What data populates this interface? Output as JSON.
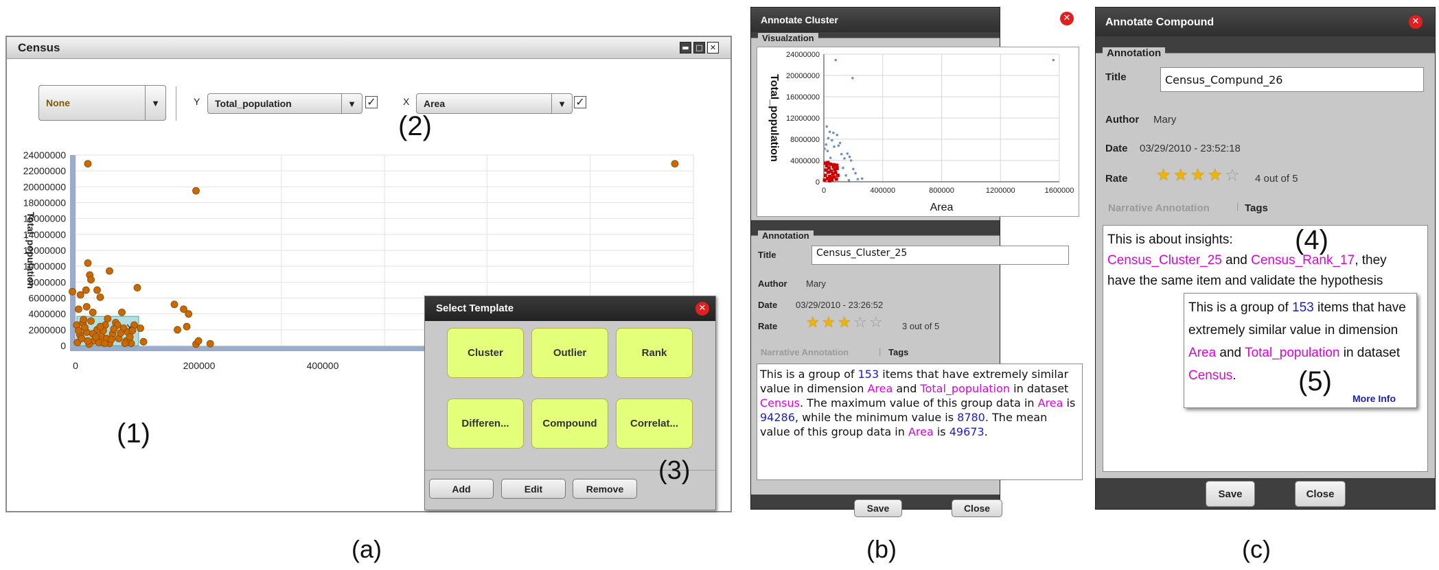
{
  "panel_a": {
    "window_title": "Census",
    "color_by": "None",
    "y_axis_letter": "Y",
    "y_axis_field": "Total_population",
    "y_checked": true,
    "x_axis_letter": "X",
    "x_axis_field": "Area",
    "x_checked": true,
    "selection_close": "X",
    "select_template": {
      "title": "Select Template",
      "templates": [
        "Cluster",
        "Outlier",
        "Rank",
        "Differen...",
        "Compound",
        "Correlat..."
      ],
      "buttons": {
        "add": "Add",
        "edit": "Edit",
        "remove": "Remove"
      }
    },
    "callouts": {
      "c1": "(1)",
      "c2": "(2)",
      "c3": "(3)"
    },
    "sub_label": "(a)"
  },
  "panel_b": {
    "dialog_title": "Annotate Cluster",
    "visualization_legend": "Visualzation",
    "annotation_legend": "Annotation",
    "title_label": "Title",
    "title_value": "Census_Cluster_25",
    "author_label": "Author",
    "author_value": "Mary",
    "date_label": "Date",
    "date_value": "03/29/2010 - 23:26:52",
    "rate_label": "Rate",
    "rating": 3,
    "rating_text": "3 out of 5",
    "tab_narrative": "Narrative Annotation",
    "tab_separator": "|",
    "tab_tags": "Tags",
    "narrative": [
      {
        "t": "This is a group of ",
        "c": ""
      },
      {
        "t": "153",
        "c": "blue"
      },
      {
        "t": " items that have extremely similar value in dimension ",
        "c": ""
      },
      {
        "t": "Area",
        "c": "magenta"
      },
      {
        "t": " and ",
        "c": ""
      },
      {
        "t": "Total_population",
        "c": "magenta"
      },
      {
        "t": " in dataset ",
        "c": ""
      },
      {
        "t": "Census",
        "c": "magenta"
      },
      {
        "t": ". The maximum value of this group data in ",
        "c": ""
      },
      {
        "t": "Area",
        "c": "magenta"
      },
      {
        "t": " is ",
        "c": ""
      },
      {
        "t": "94286",
        "c": "blue"
      },
      {
        "t": ", while the minimum value is ",
        "c": ""
      },
      {
        "t": "8780",
        "c": "blue"
      },
      {
        "t": ". The mean value of this group data in ",
        "c": ""
      },
      {
        "t": "Area",
        "c": "magenta"
      },
      {
        "t": " is ",
        "c": ""
      },
      {
        "t": "49673",
        "c": "blue"
      },
      {
        "t": ".",
        "c": ""
      }
    ],
    "save": "Save",
    "close": "Close",
    "sub_label": "(b)"
  },
  "panel_c": {
    "dialog_title": "Annotate Compound",
    "annotation_legend": "Annotation",
    "title_label": "Title",
    "title_value": "Census_Compund_26",
    "author_label": "Author",
    "author_value": "Mary",
    "date_label": "Date",
    "date_value": "03/29/2010 - 23:52:18",
    "rate_label": "Rate",
    "rating": 4,
    "rating_text": "4 out of 5",
    "tab_narrative": "Narrative Annotation",
    "tab_separator": "|",
    "tab_tags": "Tags",
    "narrative_line1": "This is about insights:",
    "narrative_link1": "Census_Cluster_25",
    "narrative_and": " and ",
    "narrative_link2": "Census_Rank_17",
    "narrative_rest": ", they",
    "narrative_line3": "have the same item and validate the hypothesis",
    "tooltip": [
      {
        "t": "This is a group of ",
        "c": ""
      },
      {
        "t": "153",
        "c": "blue"
      },
      {
        "t": " items that have extremely similar value in dimension ",
        "c": ""
      },
      {
        "t": "Area",
        "c": "magenta"
      },
      {
        "t": " and ",
        "c": ""
      },
      {
        "t": "Total_population",
        "c": "magenta"
      },
      {
        "t": " in dataset ",
        "c": ""
      },
      {
        "t": "Census",
        "c": "magenta"
      },
      {
        "t": ".",
        "c": ""
      }
    ],
    "more_info": "More Info",
    "callouts": {
      "c4": "(4)",
      "c5": "(5)"
    },
    "save": "Save",
    "close": "Close",
    "sub_label": "(c)"
  },
  "chart_data": [
    {
      "type": "scatter",
      "title": "",
      "xlabel": "",
      "ylabel": "Total_population",
      "x_ticks": [
        0,
        200000,
        400000
      ],
      "y_ticks": [
        0,
        2000000,
        4000000,
        6000000,
        8000000,
        10000000,
        12000000,
        14000000,
        16000000,
        18000000,
        20000000,
        22000000,
        24000000
      ],
      "xlim": [
        0,
        1000000
      ],
      "ylim": [
        0,
        24000000
      ],
      "grid": true,
      "selection": {
        "x_range": [
          0,
          100000
        ],
        "y_range": [
          0,
          3700000
        ]
      },
      "color": "#c96a00",
      "points": [
        [
          20000,
          22900000
        ],
        [
          195000,
          19500000
        ],
        [
          970000,
          22900000
        ],
        [
          20000,
          10400000
        ],
        [
          23000,
          8900000
        ],
        [
          25000,
          8300000
        ],
        [
          55000,
          9400000
        ],
        [
          -5000,
          6800000
        ],
        [
          8000,
          6400000
        ],
        [
          17000,
          7000000
        ],
        [
          35000,
          7000000
        ],
        [
          40000,
          6100000
        ],
        [
          100000,
          7300000
        ],
        [
          5000,
          4600000
        ],
        [
          18000,
          4900000
        ],
        [
          28000,
          4200000
        ],
        [
          75000,
          4200000
        ],
        [
          160000,
          5200000
        ],
        [
          175000,
          4600000
        ],
        [
          183000,
          4000000
        ],
        [
          165000,
          2000000
        ],
        [
          180000,
          2400000
        ],
        [
          195000,
          200000
        ],
        [
          199000,
          600000
        ],
        [
          218000,
          250000
        ],
        [
          110000,
          500000
        ],
        [
          105000,
          2200000
        ],
        [
          2000,
          2600000
        ],
        [
          7000,
          1400000
        ],
        [
          12000,
          2900000
        ],
        [
          18000,
          1700000
        ],
        [
          25000,
          3100000
        ],
        [
          30000,
          600000
        ],
        [
          35000,
          2000000
        ],
        [
          42000,
          1200000
        ],
        [
          48000,
          2600000
        ],
        [
          55000,
          300000
        ],
        [
          60000,
          1500000
        ],
        [
          65000,
          2900000
        ],
        [
          70000,
          900000
        ],
        [
          78000,
          2200000
        ],
        [
          85000,
          1700000
        ],
        [
          90000,
          300000
        ],
        [
          95000,
          2600000
        ],
        [
          3000,
          400000
        ],
        [
          10000,
          900000
        ],
        [
          22000,
          200000
        ],
        [
          38000,
          400000
        ],
        [
          50000,
          900000
        ],
        [
          68000,
          2600000
        ],
        [
          82000,
          600000
        ],
        [
          15000,
          2300000
        ],
        [
          28000,
          1500000
        ],
        [
          45000,
          1900000
        ],
        [
          58000,
          800000
        ],
        [
          73000,
          1600000
        ],
        [
          88000,
          1100000
        ],
        [
          5000,
          1900000
        ],
        [
          40000,
          2400000
        ],
        [
          62000,
          2100000
        ],
        [
          20000,
          600000
        ],
        [
          33000,
          1100000
        ],
        [
          47000,
          300000
        ],
        [
          80000,
          300000
        ],
        [
          92000,
          1900000
        ],
        [
          13000,
          3300000
        ],
        [
          52000,
          3400000
        ]
      ]
    },
    {
      "type": "scatter",
      "title": "",
      "xlabel": "Area",
      "ylabel": "Total_population",
      "x_ticks": [
        0,
        400000,
        800000,
        1200000,
        1600000
      ],
      "y_ticks": [
        0,
        4000000,
        8000000,
        12000000,
        16000000,
        20000000,
        24000000
      ],
      "xlim": [
        0,
        1600000
      ],
      "ylim": [
        0,
        24000000
      ],
      "grid": true,
      "color": "#6a8fd0",
      "highlight_color": "#cc0000",
      "points": [
        [
          80000,
          22900000
        ],
        [
          195000,
          19500000
        ],
        [
          1560000,
          22900000
        ],
        [
          20000,
          10400000
        ],
        [
          40000,
          9400000
        ],
        [
          65000,
          9200000
        ],
        [
          90000,
          8800000
        ],
        [
          30000,
          8200000
        ],
        [
          55000,
          7800000
        ],
        [
          110000,
          7300000
        ],
        [
          15000,
          7000000
        ],
        [
          70000,
          6600000
        ],
        [
          100000,
          6800000
        ],
        [
          25000,
          5800000
        ],
        [
          120000,
          5200000
        ],
        [
          160000,
          5300000
        ],
        [
          175000,
          4700000
        ],
        [
          185000,
          4000000
        ],
        [
          140000,
          4400000
        ],
        [
          45000,
          4500000
        ],
        [
          200000,
          2400000
        ],
        [
          215000,
          1600000
        ],
        [
          230000,
          500000
        ],
        [
          260000,
          600000
        ],
        [
          150000,
          1200000
        ],
        [
          130000,
          2600000
        ],
        [
          170000,
          300000
        ],
        [
          5000,
          6200000
        ]
      ],
      "highlight_points": [
        [
          5000,
          300000
        ],
        [
          10000,
          1200000
        ],
        [
          15000,
          2200000
        ],
        [
          20000,
          3000000
        ],
        [
          25000,
          600000
        ],
        [
          30000,
          1800000
        ],
        [
          35000,
          2600000
        ],
        [
          40000,
          1000000
        ],
        [
          45000,
          3300000
        ],
        [
          50000,
          2000000
        ],
        [
          55000,
          400000
        ],
        [
          60000,
          1500000
        ],
        [
          65000,
          2800000
        ],
        [
          70000,
          900000
        ],
        [
          75000,
          2300000
        ],
        [
          80000,
          1700000
        ],
        [
          85000,
          500000
        ],
        [
          90000,
          2500000
        ],
        [
          95000,
          1200000
        ],
        [
          12000,
          3500000
        ],
        [
          28000,
          3600000
        ],
        [
          48000,
          800000
        ],
        [
          68000,
          3200000
        ],
        [
          88000,
          3100000
        ],
        [
          38000,
          200000
        ]
      ]
    }
  ]
}
